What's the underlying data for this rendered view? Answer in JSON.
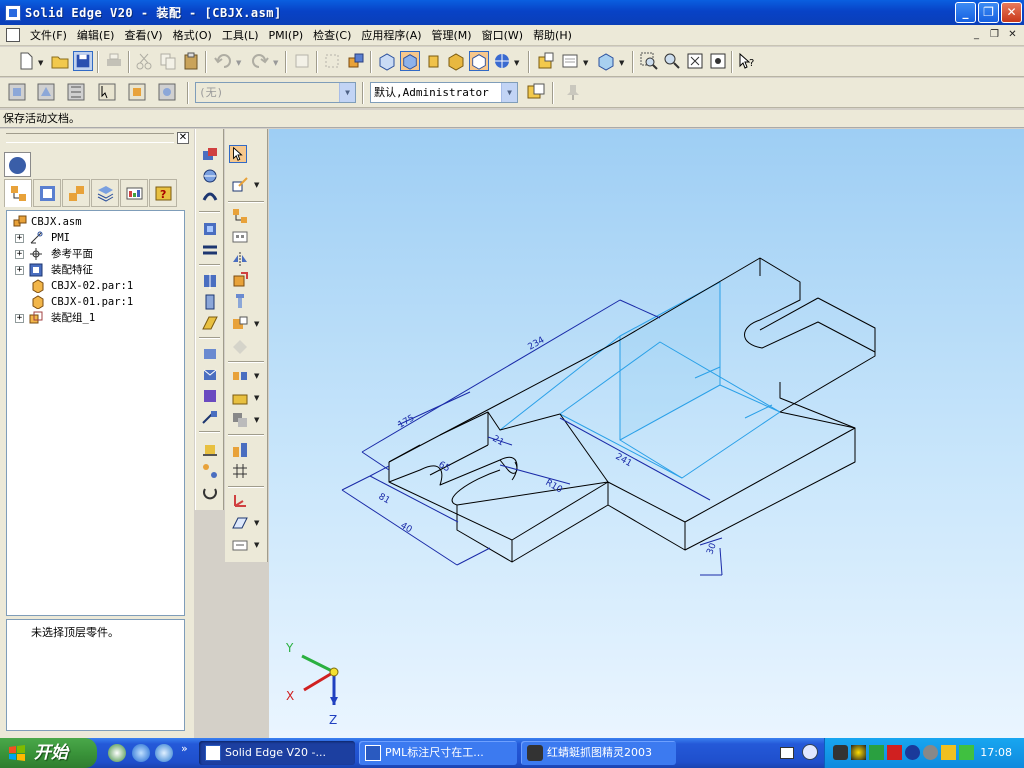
{
  "window": {
    "title": "Solid Edge V20 - 装配 - [CBJX.asm]",
    "controls": {
      "minimize": "_",
      "maximize": "❐",
      "close": "✕"
    }
  },
  "menu": {
    "items": [
      "文件(F)",
      "编辑(E)",
      "查看(V)",
      "格式(O)",
      "工具(L)",
      "PMI(P)",
      "检查(C)",
      "应用程序(A)",
      "管理(M)",
      "窗口(W)",
      "帮助(H)"
    ],
    "mdi_controls": {
      "minimize": "_",
      "restore": "❐",
      "close": "✕"
    }
  },
  "toolbar2": {
    "layer_combo": "(无)",
    "user_combo": "默认,Administrator"
  },
  "status_message": "保存活动文档。",
  "tree": {
    "items": [
      {
        "label": "CBJX.asm",
        "expander": "",
        "icon": "assembly-icon"
      },
      {
        "label": "PMI",
        "expander": "+",
        "icon": "pmi-icon"
      },
      {
        "label": "参考平面",
        "expander": "+",
        "icon": "reference-plane-icon"
      },
      {
        "label": "装配特征",
        "expander": "+",
        "icon": "assembly-features-icon"
      },
      {
        "label": "CBJX-02.par:1",
        "expander": "",
        "icon": "part-icon"
      },
      {
        "label": "CBJX-01.par:1",
        "expander": "",
        "icon": "part-icon"
      },
      {
        "label": "装配组_1",
        "expander": "+",
        "icon": "subassembly-icon"
      }
    ]
  },
  "info_text": "未选择顶层零件。",
  "dimensions": {
    "overall_length": "234",
    "width_back": "175",
    "center_length": "241",
    "slot_depth": "65",
    "slot_width": "20",
    "tab_width": "81",
    "tab_offset": "40",
    "radius": "R10",
    "thickness": "30",
    "small_offset": "21"
  },
  "triad": {
    "y": "Y",
    "x": "X",
    "z": "Z"
  },
  "colors": {
    "title_bar": "#0a48d0",
    "model_lines": "#000000",
    "dimension_lines": "#1a2aa8",
    "selection_highlight": "#2aa0e8",
    "viewport_top": "#9ecef4",
    "viewport_bottom": "#eaf5ff",
    "start_button": "#3a943a"
  },
  "taskbar": {
    "start_label": "开始",
    "tasks": [
      {
        "label": "Solid Edge V20 -...",
        "active": true
      },
      {
        "label": "PML标注尺寸在工...",
        "active": false
      },
      {
        "label": "红蜻蜓抓图精灵2003",
        "active": false
      }
    ],
    "clock": "17:08"
  }
}
